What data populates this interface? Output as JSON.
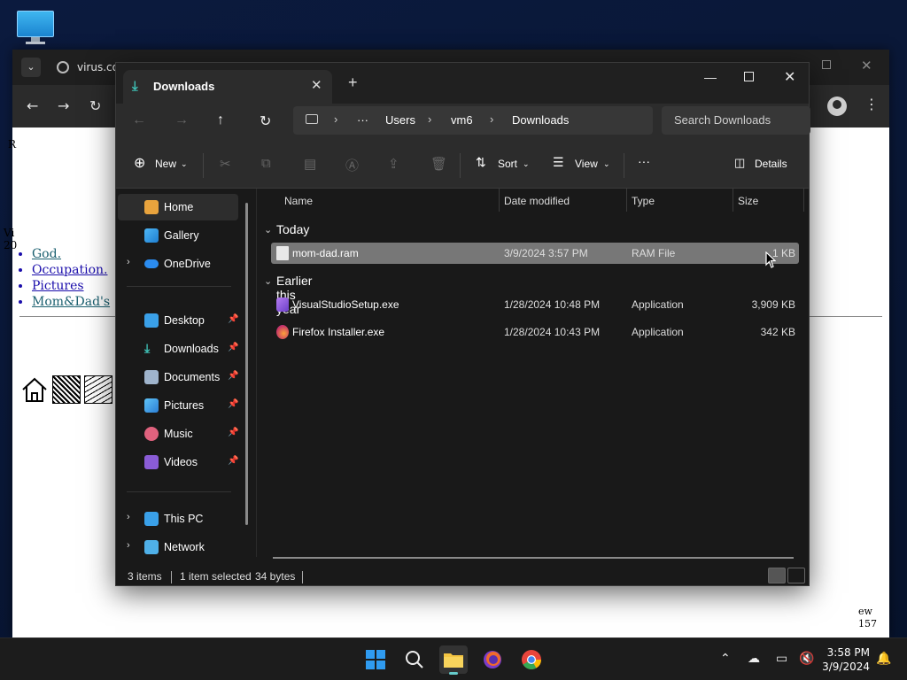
{
  "desktop": {
    "icon_name": "monitor-icon"
  },
  "browser": {
    "tab_title": "virus.co",
    "page": {
      "frag1": "R",
      "frag2_line1": "Vi",
      "frag2_line2": "20",
      "links": [
        "God.",
        "Occupation.",
        "Pictures",
        "Mom&Dad's"
      ],
      "frag3_line1": "ew",
      "frag3_line2": "157"
    }
  },
  "explorer": {
    "tab_title": "Downloads",
    "breadcrumbs": [
      "Users",
      "vm6",
      "Downloads"
    ],
    "breadcrumb_more": "···",
    "search_placeholder": "Search Downloads",
    "commands": {
      "new": "New",
      "sort": "Sort",
      "view": "View",
      "more": "···",
      "details": "Details"
    },
    "nav": {
      "home": "Home",
      "gallery": "Gallery",
      "onedrive": "OneDrive",
      "desktop": "Desktop",
      "downloads": "Downloads",
      "documents": "Documents",
      "pictures": "Pictures",
      "music": "Music",
      "videos": "Videos",
      "thispc": "This PC",
      "network": "Network"
    },
    "columns": {
      "name": "Name",
      "date": "Date modified",
      "type": "Type",
      "size": "Size"
    },
    "groups": {
      "today": {
        "label": "Today",
        "files": [
          {
            "name": "mom-dad.ram",
            "date": "3/9/2024 3:57 PM",
            "type": "RAM File",
            "size": "1 KB"
          }
        ]
      },
      "earlier": {
        "label": "Earlier this year",
        "files": [
          {
            "name": "VisualStudioSetup.exe",
            "date": "1/28/2024 10:48 PM",
            "type": "Application",
            "size": "3,909 KB"
          },
          {
            "name": "Firefox Installer.exe",
            "date": "1/28/2024 10:43 PM",
            "type": "Application",
            "size": "342 KB"
          }
        ]
      }
    },
    "status": {
      "items": "3 items",
      "selected": "1 item selected",
      "size": "34 bytes"
    }
  },
  "taskbar": {
    "time": "3:58 PM",
    "date": "3/9/2024",
    "accent": "#0078d4"
  }
}
